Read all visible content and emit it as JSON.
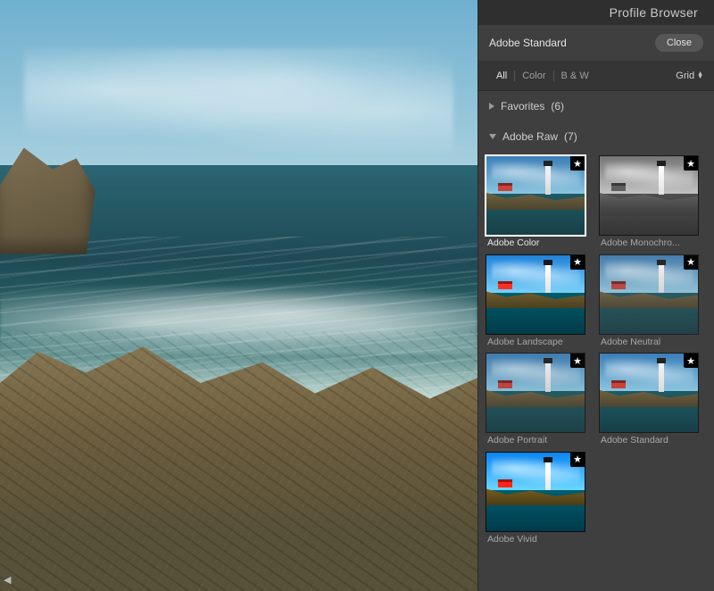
{
  "panel": {
    "title": "Profile Browser",
    "current_profile": "Adobe Standard",
    "close_label": "Close",
    "tabs": {
      "all": "All",
      "color": "Color",
      "bw": "B & W"
    },
    "view_label": "Grid"
  },
  "sections": {
    "favorites": {
      "label": "Favorites",
      "count": "(6)"
    },
    "adobe_raw": {
      "label": "Adobe Raw",
      "count": "(7)"
    }
  },
  "profiles": [
    {
      "label": "Adobe Color",
      "variant": "v-color",
      "selected": true
    },
    {
      "label": "Adobe Monochro...",
      "variant": "v-mono",
      "selected": false
    },
    {
      "label": "Adobe Landscape",
      "variant": "v-landscape",
      "selected": false
    },
    {
      "label": "Adobe Neutral",
      "variant": "v-neutral",
      "selected": false
    },
    {
      "label": "Adobe Portrait",
      "variant": "v-portrait",
      "selected": false
    },
    {
      "label": "Adobe Standard",
      "variant": "v-standard",
      "selected": false
    },
    {
      "label": "Adobe Vivid",
      "variant": "v-vivid",
      "selected": false
    }
  ]
}
